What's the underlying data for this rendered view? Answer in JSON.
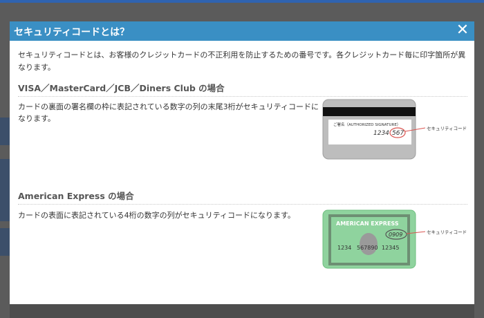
{
  "modal": {
    "title": "セキュリティコードとは？",
    "close_symbol": "✕",
    "intro": "セキュリティコードとは、お客様のクレジットカードの不正利用を防止するための番号です。各クレジットカード毎に印字箇所が異なります。"
  },
  "section_visa": {
    "title": "VISA／MasterCard／JCB／Diners Club の場合",
    "description": "カードの裏面の署名欄の枠に表記されている数字の列の末尾3桁がセキュリティコードになります。",
    "card": {
      "signature_label": "ご署名（AUTHORIZED SIGNATURE）",
      "numbers": "1234",
      "code": "567",
      "callout": "セキュリティコード"
    }
  },
  "section_amex": {
    "title": "American Express の場合",
    "description": "カードの表面に表記されている4桁の数字の列がセキュリティコードになります。",
    "card": {
      "brand": "AMERICAN EXPRESS",
      "code": "0909",
      "num1": "1234",
      "num2": "567890",
      "num3": "12345",
      "callout": "セキュリティコード"
    }
  },
  "colors": {
    "header": "#3a8fc4",
    "amex_card": "#8fd39e",
    "visa_card": "#bdbdbd",
    "callout_line": "#d9534f"
  }
}
